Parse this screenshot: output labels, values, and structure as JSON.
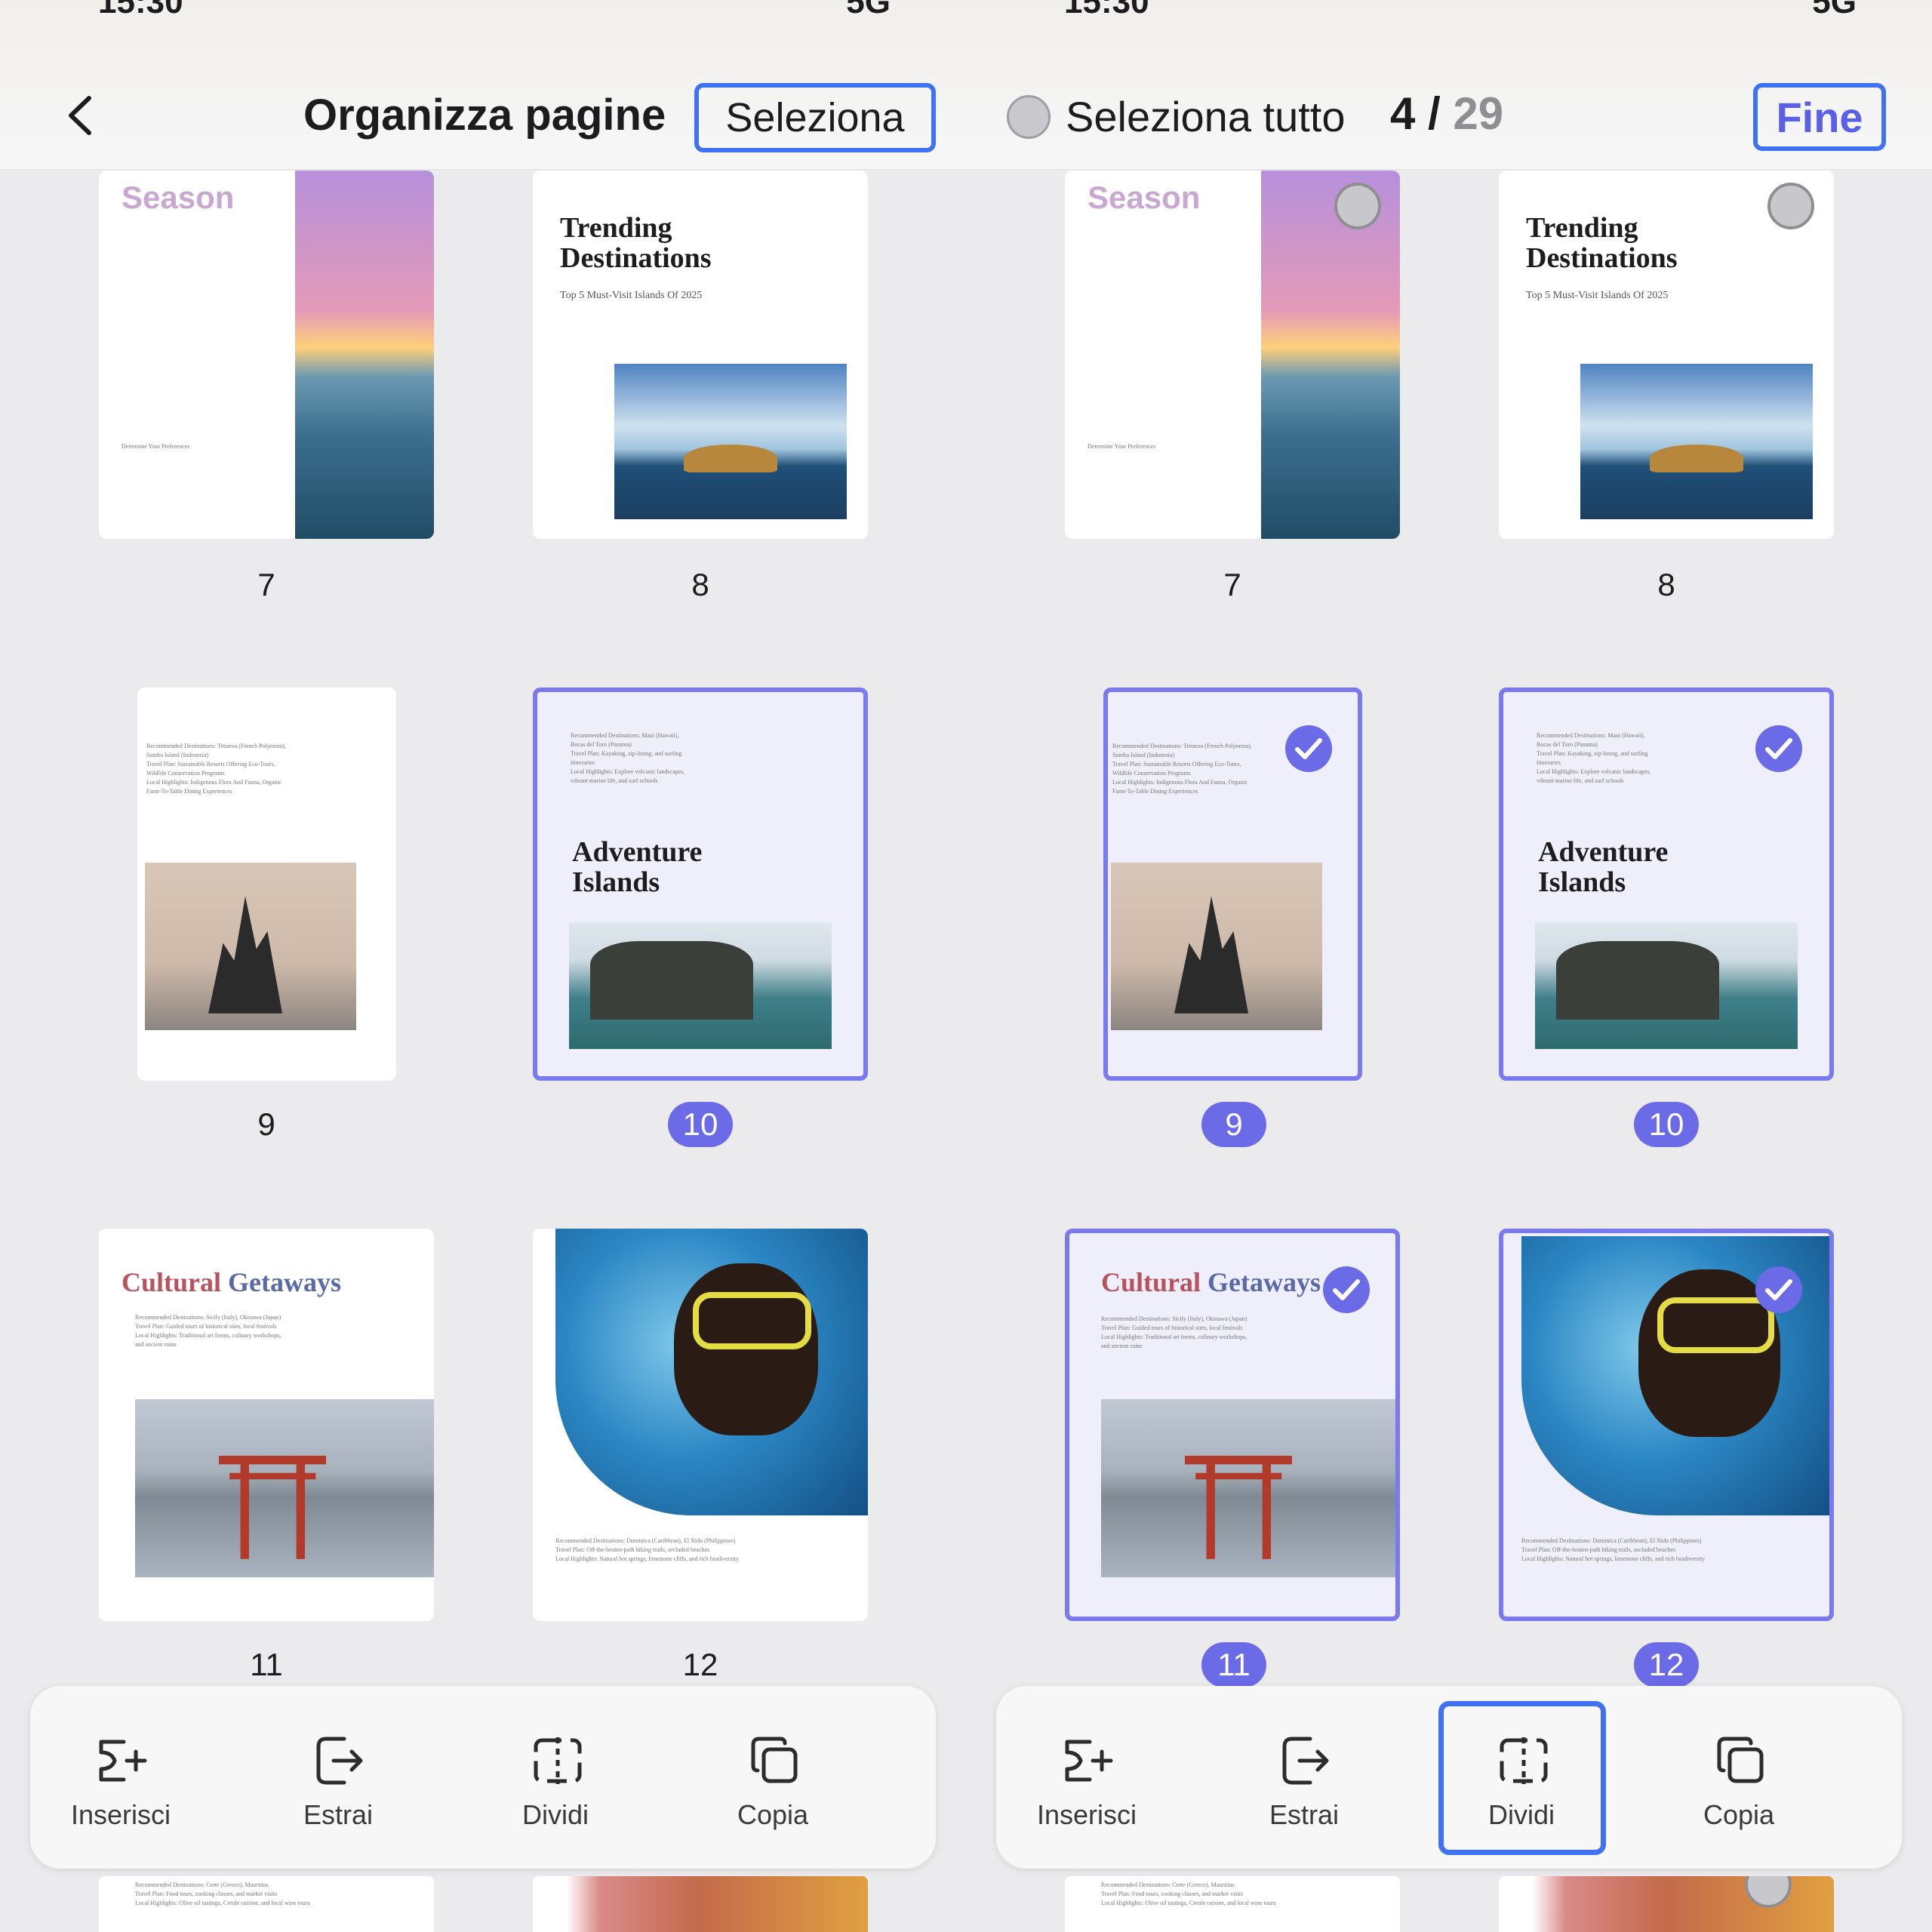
{
  "status": {
    "time": "15:30",
    "signal_label": "5G"
  },
  "header": {
    "title": "Organizza pagine",
    "select_label": "Seleziona",
    "select_all_label": "Seleziona tutto",
    "count_current": "4",
    "count_separator": "/",
    "count_total": "29",
    "done_label": "Fine"
  },
  "pages": {
    "p7": {
      "number": "7",
      "season": "Season",
      "pref_title": "Determine Your Preferences"
    },
    "p8": {
      "number": "8",
      "title_line1": "Trending",
      "title_line2": "Destinations",
      "subtitle": "Top 5 Must-Visit Islands Of 2025"
    },
    "p9": {
      "number": "9",
      "lines": [
        "Recommended Destinations: Tetiaroa (French Polynesia),",
        "Sumba Island (Indonesia)",
        "Travel Plan: Sustainable Resorts Offering Eco-Tours,",
        "Wildlife Conservation Programs",
        "Local Highlights: Indigenous Flora And Fauna, Organic",
        "Farm-To-Table Dining Experiences"
      ]
    },
    "p10": {
      "number": "10",
      "title_line1": "Adventure",
      "title_line2": "Islands",
      "lines": [
        "Recommended Destinations: Maui (Hawaii),",
        "Bocas del Toro (Panama)",
        "Travel Plan: Kayaking, zip-lining, and surfing",
        "itineraries",
        "Local Highlights: Explore volcanic landscapes,",
        "vibrant marine life, and surf schools"
      ]
    },
    "p11": {
      "number": "11",
      "title_a": "Cultural",
      "title_b": "Getaways",
      "title_cut": "Cultural Getawa",
      "lines": [
        "Recommended Destinations: Sicily (Italy), Okinawa (Japan)",
        "Travel Plan: Guided tours of historical sites, local festivals",
        "Local Highlights: Traditional art forms, culinary workshops,",
        "and ancient ruins"
      ]
    },
    "p12": {
      "number": "12",
      "lines": [
        "Recommended Destinations: Dominica (Caribbean), El Nido (Philippines)",
        "Travel Plan: Off-the-beaten-path hiking trails, secluded beaches",
        "Local Highlights: Natural hot springs, limestone cliffs, and rich biodiversity"
      ]
    },
    "p13": {
      "lines": [
        "Recommended Destinations: Crete (Greece), Mauritius",
        "Travel Plan: Food tours, cooking classes, and market visits",
        "Local Highlights: Olive oil tastings, Creole cuisine, and local wine tours"
      ]
    }
  },
  "toolbar": {
    "insert_label": "Inserisci",
    "extract_label": "Estrai",
    "split_label": "Dividi",
    "copy_label": "Copia"
  },
  "colors": {
    "accent": "#6b6be8",
    "highlight": "#3e72f2"
  }
}
